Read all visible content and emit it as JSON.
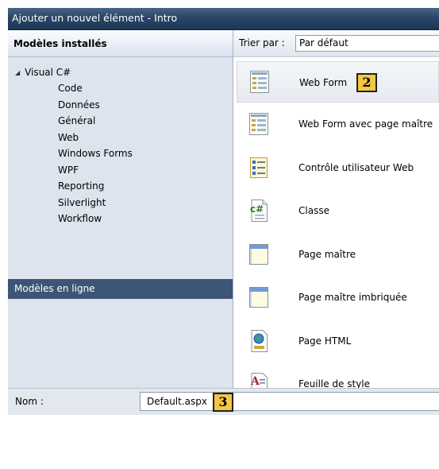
{
  "window": {
    "title": "Ajouter un nouvel élément - Intro"
  },
  "left_panel": {
    "header": "Modèles installés",
    "tree": {
      "root": "Visual C#",
      "items": [
        "Code",
        "Données",
        "Général",
        "Web",
        "Windows Forms",
        "WPF",
        "Reporting",
        "Silverlight",
        "Workflow"
      ]
    },
    "online_templates": "Modèles en ligne"
  },
  "sort": {
    "label": "Trier par :",
    "value": "Par défaut"
  },
  "templates": [
    {
      "label": "Web Form",
      "icon": "webform-icon",
      "selected": true
    },
    {
      "label": "Web Form avec page maître",
      "icon": "webform-master-icon"
    },
    {
      "label": "Contrôle utilisateur Web",
      "icon": "user-control-icon"
    },
    {
      "label": "Classe",
      "icon": "csharp-class-icon"
    },
    {
      "label": "Page maître",
      "icon": "master-page-icon"
    },
    {
      "label": "Page maître imbriquée",
      "icon": "nested-master-page-icon"
    },
    {
      "label": "Page HTML",
      "icon": "html-page-icon"
    },
    {
      "label": "Feuille de style",
      "icon": "stylesheet-icon"
    }
  ],
  "callouts": {
    "template_badge": "2",
    "name_badge": "3"
  },
  "name_field": {
    "label": "Nom :",
    "value": "Default.aspx"
  },
  "colors": {
    "titlebar": "#2c4969",
    "online_bar": "#3d5677",
    "left_panel": "#dde4ee",
    "badge": "#f2c744"
  }
}
